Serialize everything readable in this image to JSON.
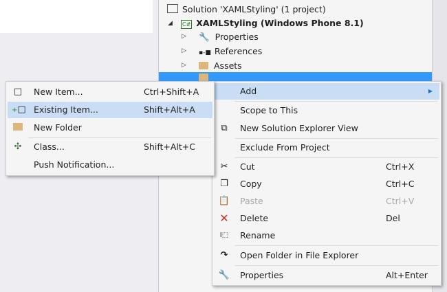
{
  "tree": {
    "solution": "Solution 'XAMLStyling' (1 project)",
    "project": "XAMLStyling (Windows Phone 8.1)",
    "items": [
      "Properties",
      "References",
      "Assets"
    ]
  },
  "context_menu": {
    "add": "Add",
    "scope": "Scope to This",
    "new_view": "New Solution Explorer View",
    "exclude": "Exclude From Project",
    "cut": {
      "label": "Cut",
      "shortcut": "Ctrl+X"
    },
    "copy": {
      "label": "Copy",
      "shortcut": "Ctrl+C"
    },
    "paste": {
      "label": "Paste",
      "shortcut": "Ctrl+V"
    },
    "delete": {
      "label": "Delete",
      "shortcut": "Del"
    },
    "rename": "Rename",
    "open_folder": "Open Folder in File Explorer",
    "properties": {
      "label": "Properties",
      "shortcut": "Alt+Enter"
    }
  },
  "submenu": {
    "new_item": {
      "label": "New Item...",
      "shortcut": "Ctrl+Shift+A"
    },
    "existing_item": {
      "label": "Existing Item...",
      "shortcut": "Shift+Alt+A"
    },
    "new_folder": "New Folder",
    "class": {
      "label": "Class...",
      "shortcut": "Shift+Alt+C"
    },
    "push": "Push Notification..."
  },
  "colors": {
    "selection": "#3399ff",
    "highlight": "#c9def5"
  }
}
